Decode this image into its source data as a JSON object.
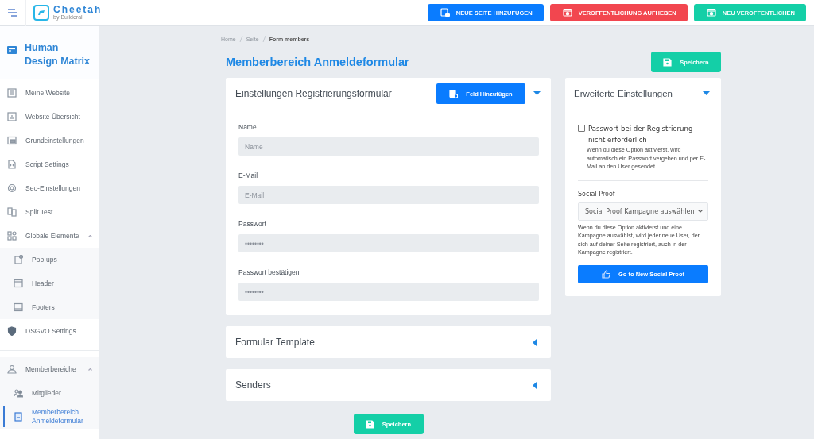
{
  "topbar": {
    "logo": {
      "name": "Cheetah",
      "tagline_prefix": "by",
      "tagline": "Builderall"
    },
    "buttons": [
      {
        "label": "NEUE SEITE HINZUFÜGEN",
        "color": "#0a7cff"
      },
      {
        "label": "VERÖFFENTLICHUNG AUFHEBEN",
        "color": "#f2464f"
      },
      {
        "label": "NEU VERÖFFENTLICHEN",
        "color": "#14cfa7"
      }
    ]
  },
  "sidebar": {
    "project": "Human Design Matrix",
    "sections": [
      {
        "items": [
          {
            "label": "Meine Website",
            "selected": false
          },
          {
            "label": "Website Übersicht",
            "selected": false
          },
          {
            "label": "Grundeinstellungen",
            "selected": false
          },
          {
            "label": "Script Settings",
            "selected": false
          },
          {
            "label": "Seo-Einstellungen",
            "selected": false
          },
          {
            "label": "Split Test",
            "selected": false
          },
          {
            "label": "Globale Elemente",
            "selected": false,
            "expanded": true,
            "children": [
              {
                "label": "Pop-ups",
                "selected": false
              },
              {
                "label": "Header",
                "selected": false
              },
              {
                "label": "Footers",
                "selected": false
              }
            ]
          },
          {
            "label": "DSGVO Settings",
            "selected": false
          }
        ]
      },
      {
        "items": [
          {
            "label": "Memberbereiche",
            "selected": false,
            "expanded": true,
            "children": [
              {
                "label": "Mitglieder",
                "selected": false
              },
              {
                "label": "Memberbereich Anmeldeformular",
                "selected": true
              }
            ]
          }
        ]
      }
    ]
  },
  "main": {
    "breadcrumb": [
      "Home",
      "Seite",
      "Form members"
    ],
    "title": "Memberbereich Anmeldeformular",
    "save_button": "Speichern",
    "form_card": {
      "title": "Einstellungen Registrierungsformular",
      "add_button": "Feld Hinzufügen",
      "expanded": true,
      "fields": [
        {
          "label": "Name",
          "placeholder": "Name"
        },
        {
          "label": "E-Mail",
          "placeholder": "E-Mail"
        },
        {
          "label": "Passwort",
          "placeholder": "••••••••"
        },
        {
          "label": "Passwort bestätigen",
          "placeholder": "••••••••"
        }
      ]
    },
    "collapsed_cards": [
      {
        "title": "Formular Template",
        "expanded": false
      },
      {
        "title": "Senders",
        "expanded": false
      }
    ],
    "advanced_card": {
      "title": "Erweiterte Einstellungen",
      "expanded": true,
      "checkbox": {
        "label": "Passwort bei der Registrierung nicht erforderlich",
        "checked": false,
        "hint": "Wenn du diese Option aktivierst, wird automatisch ein Passwort vergeben und per E-Mail an den User gesendet"
      },
      "social_proof": {
        "label": "Social Proof",
        "select_value": "Social Proof Kampagne auswählen",
        "hint": "Wenn du diese Option aktivierst und eine Kampagne auswählst, wird jeder neue User, der sich auf deiner Seite registriert, auch in der Kampagne registriert.",
        "button": "Go to New Social Proof"
      }
    },
    "bottom_save_button": "Speichern"
  }
}
